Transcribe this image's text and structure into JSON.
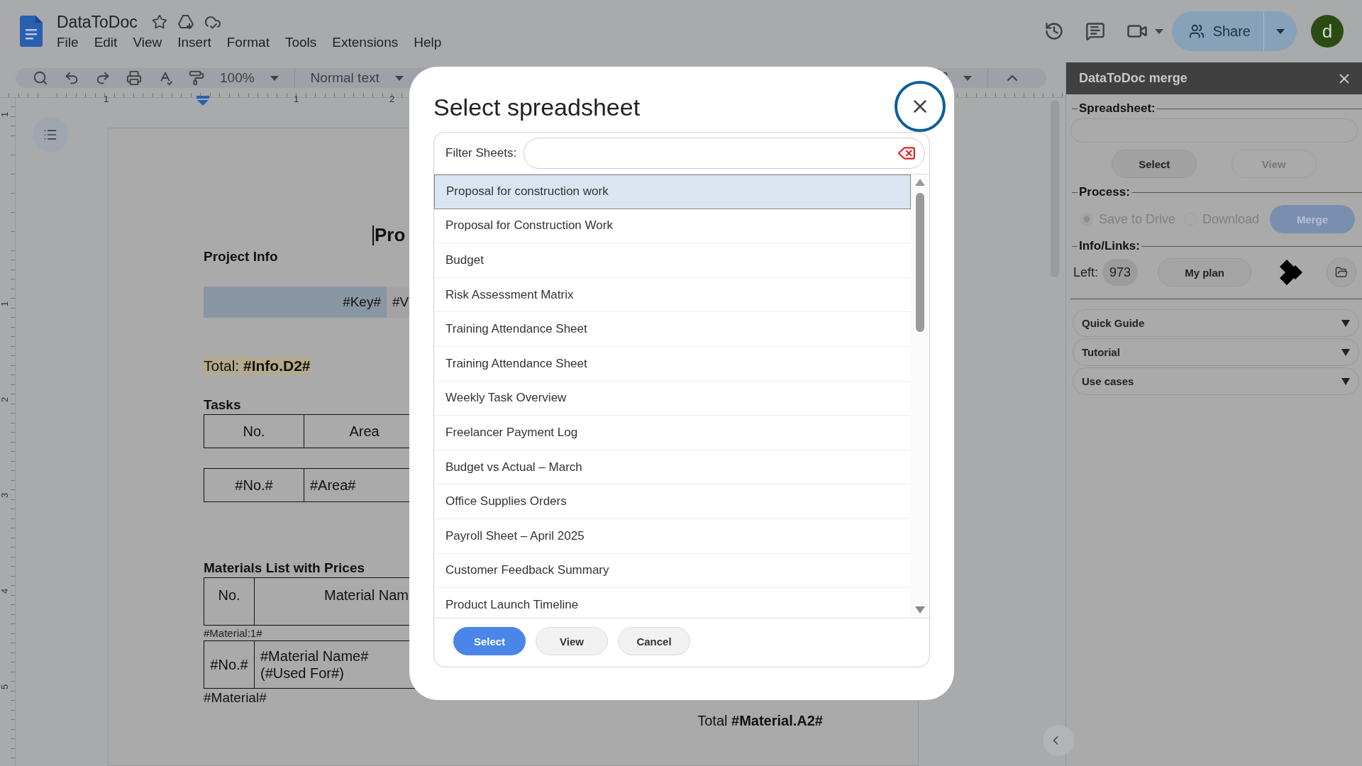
{
  "app": {
    "title": "DataToDoc",
    "menus": [
      "File",
      "Edit",
      "View",
      "Insert",
      "Format",
      "Tools",
      "Extensions",
      "Help"
    ],
    "share": "Share",
    "avatar": "d"
  },
  "toolbar": {
    "zoom": "100%",
    "style": "Normal text"
  },
  "rulers": {
    "horizontal": [
      "1",
      "1",
      "2"
    ],
    "vertical": [
      "1",
      "1",
      "2",
      "3",
      "4",
      "5"
    ]
  },
  "document": {
    "title": "Pro",
    "project_info": "Project Info",
    "key_row": [
      "#Key#",
      "#V"
    ],
    "total": "Total: **#Info.D2#**",
    "tasks_heading": "Tasks",
    "tasks_header": [
      "No.",
      "Area"
    ],
    "tasks_row": [
      "#No.#",
      "#Area#"
    ],
    "materials_heading": "Materials List with Prices",
    "materials_header": [
      "No.",
      "Material Nam"
    ],
    "materials_marker": "#Material:1#",
    "materials_row": [
      "#No.#",
      "#Material Name#\n(#Used For#)"
    ],
    "materials_end": "#Material#",
    "materials_total": "Total **#Material.A2#**"
  },
  "dialog": {
    "title": "Select spreadsheet",
    "filter_label": "Filter Sheets:",
    "items": [
      {
        "label": "Proposal for construction work",
        "selected": true
      },
      {
        "label": "Proposal for Construction Work",
        "selected": false
      },
      {
        "label": "Budget",
        "selected": false
      },
      {
        "label": "Risk Assessment Matrix",
        "selected": false
      },
      {
        "label": "Training Attendance Sheet",
        "selected": false
      },
      {
        "label": "Training Attendance Sheet",
        "selected": false
      },
      {
        "label": "Weekly Task Overview",
        "selected": false
      },
      {
        "label": "Freelancer Payment Log",
        "selected": false
      },
      {
        "label": "Budget vs Actual – March",
        "selected": false
      },
      {
        "label": "Office Supplies Orders",
        "selected": false
      },
      {
        "label": "Payroll Sheet – April 2025",
        "selected": false
      },
      {
        "label": "Customer Feedback Summary",
        "selected": false
      },
      {
        "label": "Product Launch Timeline",
        "selected": false
      }
    ],
    "buttons": [
      {
        "label": "Select",
        "kind": "primary"
      },
      {
        "label": "View",
        "kind": "secondary"
      },
      {
        "label": "Cancel",
        "kind": "secondary"
      }
    ]
  },
  "panel": {
    "title": "DataToDoc merge",
    "spreadsheet_legend": "Spreadsheet:",
    "spreadsheet_buttons": [
      {
        "label": "Select",
        "disabled": false
      },
      {
        "label": "View",
        "disabled": true
      }
    ],
    "process_legend": "Process:",
    "options": [
      {
        "label": "Save to Drive",
        "selected": true
      },
      {
        "label": "Download",
        "selected": false
      }
    ],
    "merge": "Merge",
    "info_legend": "Info/Links:",
    "left_label": "Left:",
    "left_value": "973",
    "plan": "My plan",
    "sections": [
      {
        "label": "Quick Guide",
        "expanded": false
      },
      {
        "label": "Tutorial",
        "expanded": false
      },
      {
        "label": "Use cases",
        "expanded": false
      }
    ]
  }
}
